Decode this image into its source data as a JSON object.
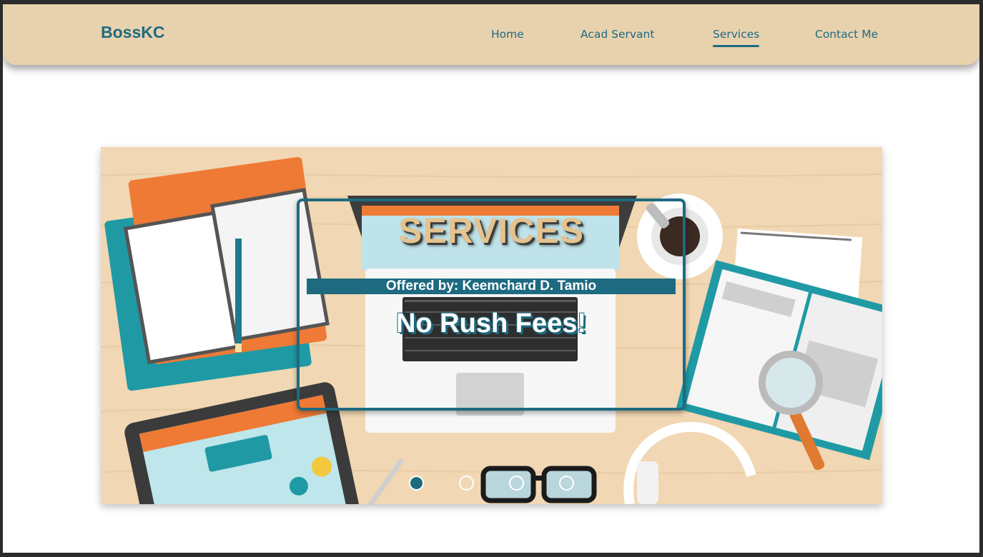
{
  "navbar": {
    "brand": "BossKC",
    "links": [
      {
        "label": "Home",
        "active": false
      },
      {
        "label": "Acad Servant",
        "active": false
      },
      {
        "label": "Services",
        "active": true
      },
      {
        "label": "Contact Me",
        "active": false
      }
    ]
  },
  "carousel": {
    "slide": {
      "title": "SERVICES",
      "offered_by": "Offered by: Keemchard D. Tamio",
      "tagline": "No Rush Fees!"
    },
    "indicators": {
      "count": 4,
      "active_index": 0
    }
  },
  "colors": {
    "brand_teal": "#1e6a80",
    "navbar_bg": "#e8d2ae",
    "title_gold": "#e4c390"
  },
  "icons": [
    "open-notebook-icon",
    "pencil-icon",
    "laptop-icon",
    "coffee-cup-icon",
    "spiral-notepad-icon",
    "magnifying-glass-icon",
    "headphones-icon",
    "glasses-icon",
    "tablet-icon"
  ]
}
